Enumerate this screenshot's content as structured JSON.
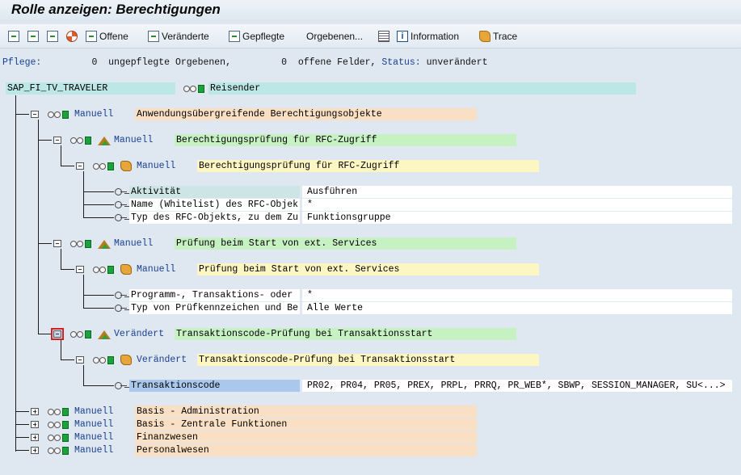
{
  "window": {
    "title": "Rolle anzeigen: Berechtigungen"
  },
  "toolbar": {
    "icons": [
      "expand-all-icon",
      "collapse-all-icon",
      "subtree-icon",
      "help-lifebuoy-icon"
    ],
    "offene": "Offene",
    "veraenderte": "Veränderte",
    "gepflegte": "Gepflegte",
    "orgebenen": "Orgebenen...",
    "information": "Information",
    "trace": "Trace"
  },
  "status": {
    "pflege_label": "Pflege:",
    "count1": "0",
    "text1": "ungepflegte Orgebenen,",
    "count2": "0",
    "text2": "offene Felder,",
    "status_label": "Status:",
    "status_value": "unverändert"
  },
  "tree": {
    "root": {
      "name": "SAP_FI_TV_TRAVELER",
      "text": "Reisender"
    },
    "class1": {
      "status": "Manuell",
      "text": "Anwendungsübergreifende Berechtigungsobjekte"
    },
    "obj1": {
      "status": "Manuell",
      "text": "Berechtigungsprüfung für RFC-Zugriff"
    },
    "auth1": {
      "status": "Manuell",
      "text": "Berechtigungsprüfung für RFC-Zugriff"
    },
    "fields1": [
      {
        "name": "Aktivität",
        "value": "Ausführen"
      },
      {
        "name": "Name (Whitelist) des RFC-Objek",
        "value": "*"
      },
      {
        "name": "Typ des RFC-Objekts, zu dem Zu",
        "value": "Funktionsgruppe"
      }
    ],
    "obj2": {
      "status": "Manuell",
      "text": "Prüfung beim Start von ext. Services"
    },
    "auth2": {
      "status": "Manuell",
      "text": "Prüfung beim Start von ext. Services"
    },
    "fields2": [
      {
        "name": "Programm-, Transaktions- oder",
        "value": "*"
      },
      {
        "name": "Typ von Prüfkennzeichen und Be",
        "value": "Alle Werte"
      }
    ],
    "obj3": {
      "status": "Verändert",
      "text": "Transaktionscode-Prüfung bei Transaktionsstart"
    },
    "auth3": {
      "status": "Verändert",
      "text": "Transaktionscode-Prüfung bei Transaktionsstart"
    },
    "fields3": [
      {
        "name": "Transaktionscode",
        "value": "PR02, PR04, PR05, PREX, PRPL, PRRQ, PR_WEB*, SBWP, SESSION_MANAGER, SU<...>"
      }
    ],
    "classes": [
      {
        "status": "Manuell",
        "text": "Basis - Administration"
      },
      {
        "status": "Manuell",
        "text": "Basis - Zentrale Funktionen"
      },
      {
        "status": "Manuell",
        "text": "Finanzwesen"
      },
      {
        "status": "Manuell",
        "text": "Personalwesen"
      }
    ]
  }
}
